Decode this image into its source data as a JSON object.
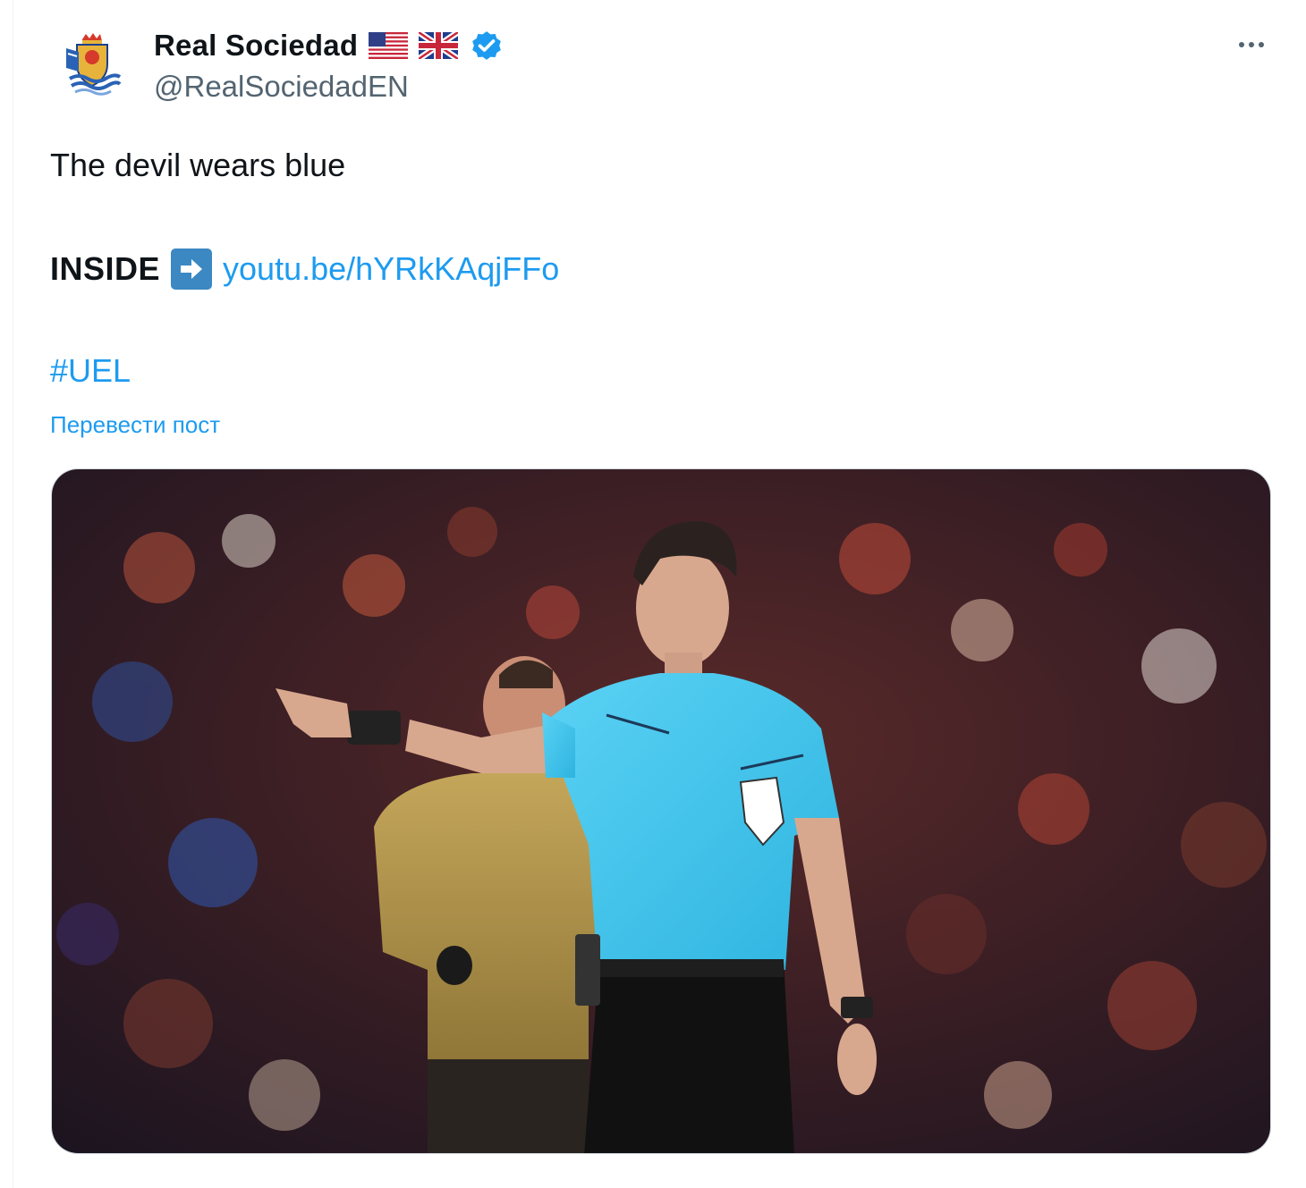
{
  "author": {
    "display_name": "Real Sociedad",
    "handle": "@RealSociedadEN",
    "verified": true,
    "flags": [
      "us-flag-icon",
      "uk-flag-icon"
    ]
  },
  "post": {
    "line1": "The devil wears blue",
    "inside_label": "INSIDE",
    "link_text": "youtu.be/hYRkKAqjFFo",
    "hashtag": "#UEL",
    "translate_label": "Перевести пост"
  },
  "media": {
    "description": "Referee in light blue shirt pointing, player in gold kit behind, stadium crowd"
  },
  "colors": {
    "link": "#1d9bf0",
    "verified": "#1d9bf0",
    "referee_shirt": "#3ec4ec",
    "player_kit": "#b59a4f"
  }
}
